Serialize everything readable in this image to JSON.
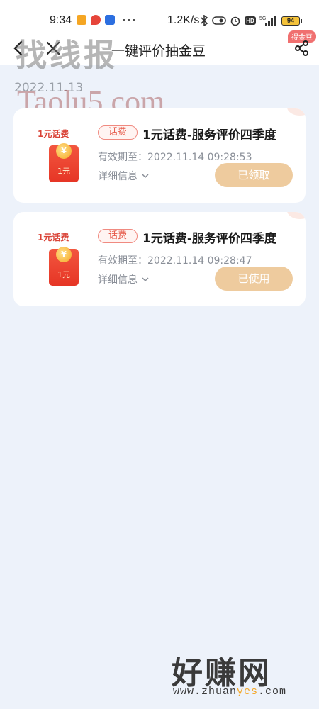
{
  "statusbar": {
    "time": "9:34",
    "more": "···",
    "speed": "1.2K/s",
    "battery": "94"
  },
  "header": {
    "title": "一键评价抽金豆",
    "share_badge": "得金豆",
    "icons": [
      "back-arrow-icon",
      "close-icon",
      "share-icon"
    ]
  },
  "watermarks": {
    "top_text": "找线报",
    "top_url": "Taolu5.com",
    "bottom_text": "好赚网",
    "bottom_url_prefix": "www.zhuan",
    "bottom_url_highlight": "yes",
    "bottom_url_suffix": ".com"
  },
  "date_label": "2022.11.13",
  "cards": [
    {
      "thumb_title": "1元话费",
      "thumb_coin": "¥",
      "thumb_amount": "1元",
      "tag": "话费",
      "title": "1元话费-服务评价四季度",
      "expiry": "有效期至：2022.11.14 09:28:53",
      "details": "详细信息",
      "status": "已领取"
    },
    {
      "thumb_title": "1元话费",
      "thumb_coin": "¥",
      "thumb_amount": "1元",
      "tag": "话费",
      "title": "1元话费-服务评价四季度",
      "expiry": "有效期至：2022.11.14 09:28:47",
      "details": "详细信息",
      "status": "已使用"
    }
  ],
  "colors": {
    "background": "#edf2fa",
    "status_button": "#eecb9e",
    "tag_red": "#e65a4a",
    "envelope_red": "#e63525"
  }
}
